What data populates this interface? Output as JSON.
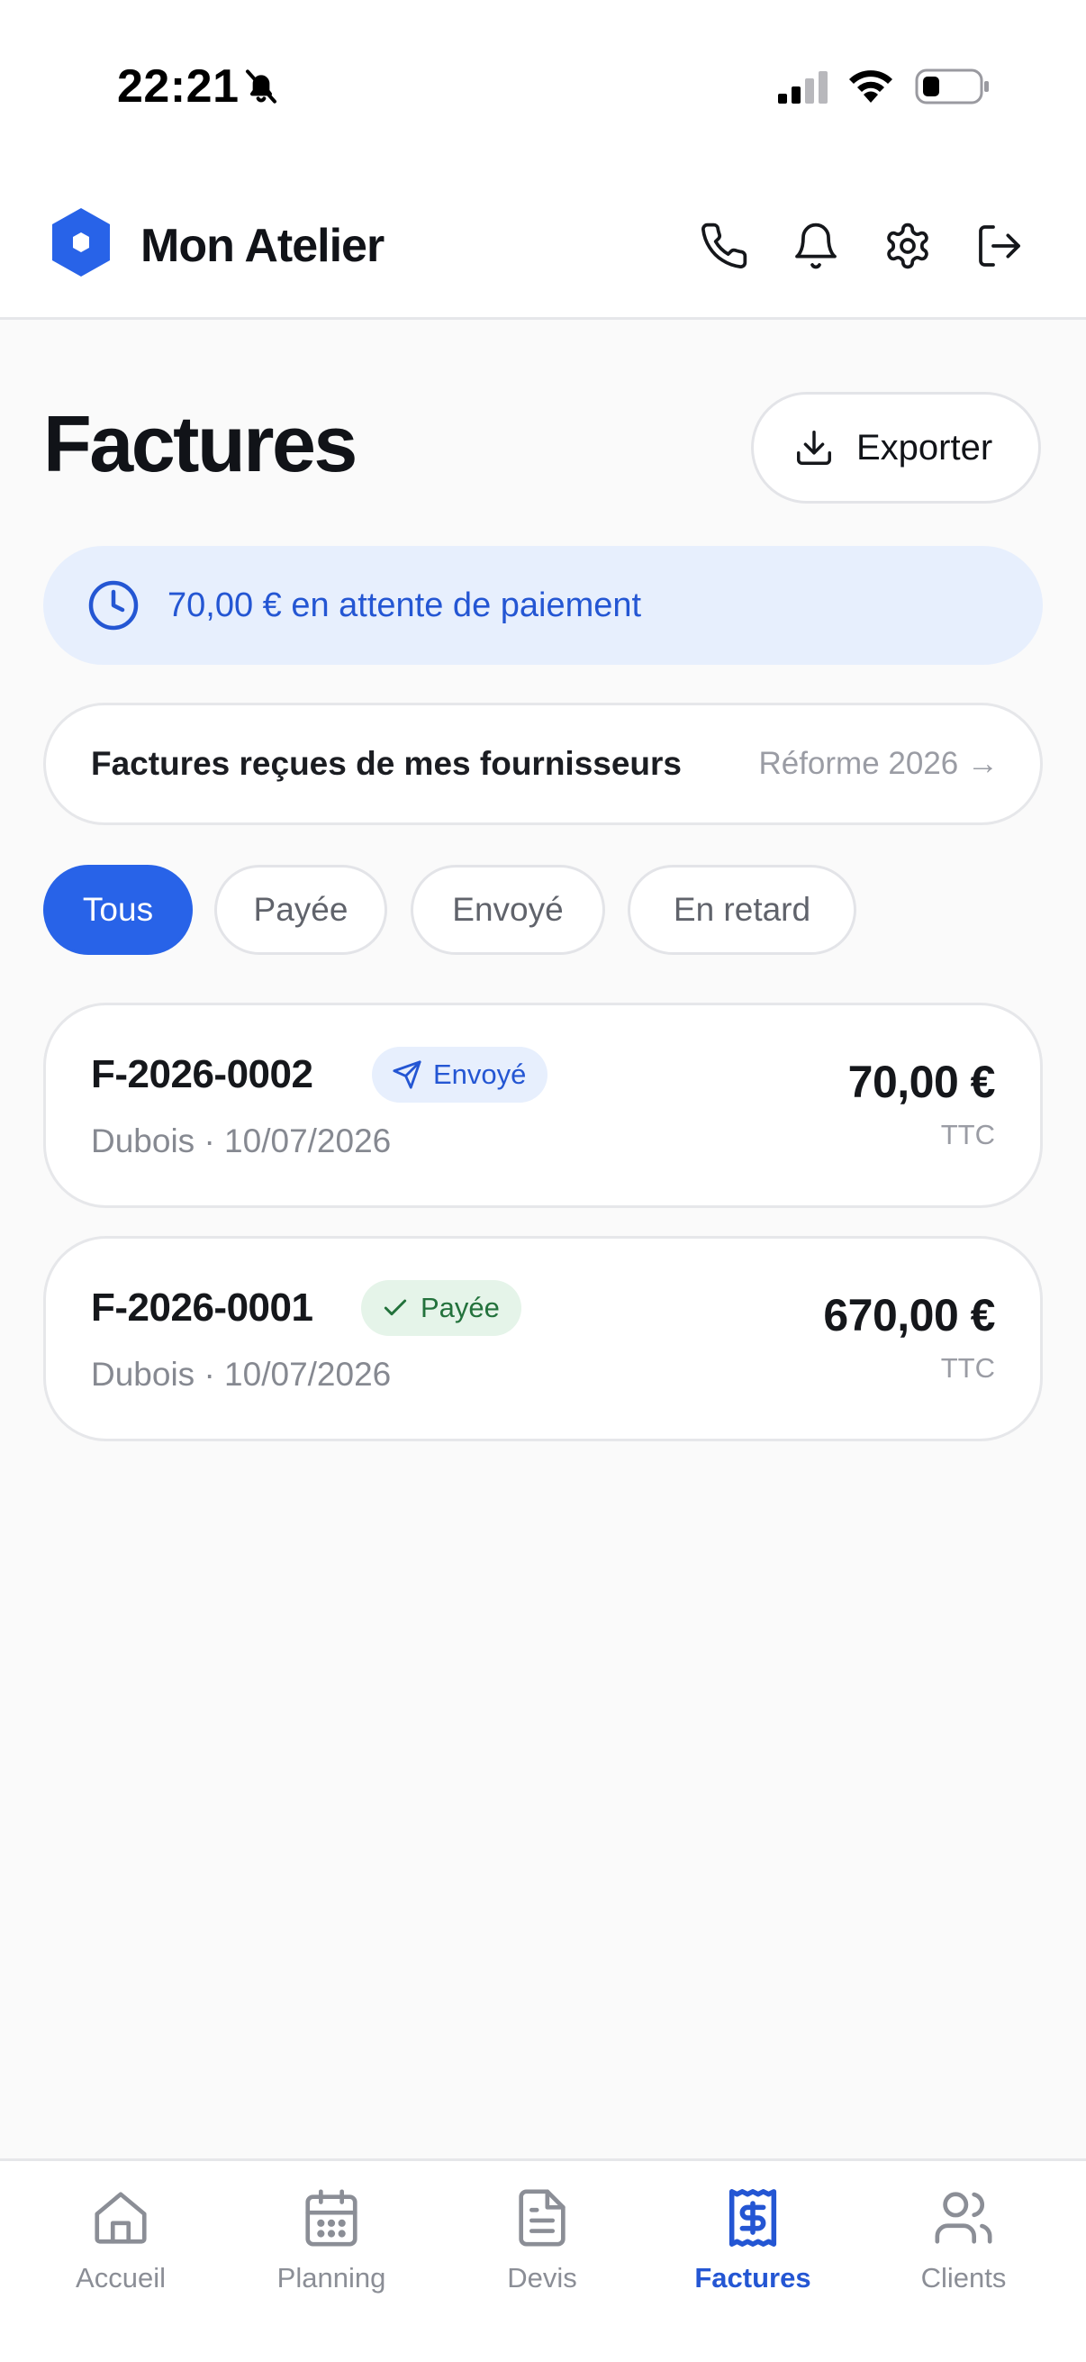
{
  "status_bar": {
    "time": "22:21",
    "icons": [
      "bell-slash-icon",
      "signal-icon",
      "wifi-icon",
      "battery-icon"
    ]
  },
  "header": {
    "app_name": "Mon Atelier",
    "logo_icon": "hexagon-logo-icon",
    "actions": [
      "phone-icon",
      "bell-icon",
      "gear-icon",
      "logout-icon"
    ]
  },
  "page": {
    "title": "Factures",
    "export_label": "Exporter"
  },
  "pending_banner": {
    "text": "70,00 € en attente de paiement"
  },
  "suppliers": {
    "label": "Factures reçues de mes fournisseurs",
    "link": "Réforme 2026 →"
  },
  "filters": {
    "active": "Tous",
    "items": [
      "Tous",
      "Payée",
      "Envoyé",
      "En retard"
    ]
  },
  "invoices": [
    {
      "number": "F-2026-0002",
      "status": "Envoyé",
      "status_icon": "send-icon",
      "meta": "Dubois · 10/07/2026",
      "amount": "70,00 €",
      "tax_label": "TTC"
    },
    {
      "number": "F-2026-0001",
      "status": "Payée",
      "status_icon": "check-icon",
      "meta": "Dubois · 10/07/2026",
      "amount": "670,00 €",
      "tax_label": "TTC"
    }
  ],
  "nav": {
    "active": "Factures",
    "items": [
      "Accueil",
      "Planning",
      "Devis",
      "Factures",
      "Clients"
    ]
  },
  "colors": {
    "accent": "#2863e8",
    "accent_text": "#2456d3",
    "banner_bg": "#e7effd",
    "paid_bg": "#e5f4e9",
    "paid_text": "#23723c",
    "page_bg": "#fafafa"
  }
}
